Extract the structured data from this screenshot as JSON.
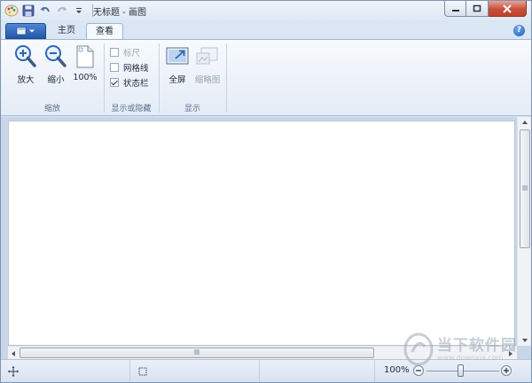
{
  "window": {
    "title": "无标题 - 画图",
    "colors": {
      "accent": "#1f57aa",
      "close": "#c7503a",
      "ribbon_bg": "#f5f8fc"
    }
  },
  "quick_access": {
    "icons": [
      "paint-app-icon",
      "save-icon",
      "undo-icon",
      "redo-icon",
      "customize-dropdown-icon"
    ]
  },
  "tabs": [
    {
      "label": "主页",
      "active": false
    },
    {
      "label": "查看",
      "active": true
    }
  ],
  "ribbon": {
    "zoom_group": {
      "label": "缩放",
      "buttons": [
        {
          "label": "放大",
          "icon": "zoom-in-icon"
        },
        {
          "label": "缩小",
          "icon": "zoom-out-icon"
        },
        {
          "label": "100%",
          "icon": "actual-size-icon"
        }
      ]
    },
    "show_hide_group": {
      "label": "显示或隐藏",
      "checkboxes": [
        {
          "label": "标尺",
          "checked": false
        },
        {
          "label": "网格线",
          "checked": false
        },
        {
          "label": "状态栏",
          "checked": true
        }
      ]
    },
    "display_group": {
      "label": "显示",
      "buttons": [
        {
          "label": "全屏",
          "icon": "fullscreen-icon",
          "enabled": true
        },
        {
          "label": "缩略图",
          "icon": "thumbnail-icon",
          "enabled": false
        }
      ]
    }
  },
  "status": {
    "zoom_label": "100%",
    "zoom_level_percent": 100
  },
  "watermark": {
    "line1": "当下软件园",
    "line2": "www.downxia.com"
  }
}
